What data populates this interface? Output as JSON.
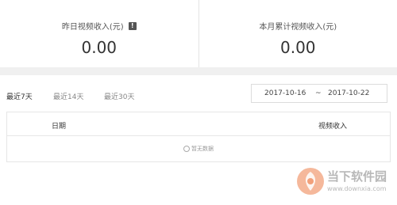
{
  "stats": [
    {
      "title": "昨日视频收入(元)",
      "value": "0.00",
      "warning_glyph": "!"
    },
    {
      "title": "本月累计视频收入(元)",
      "value": "0.00"
    }
  ],
  "tabs": [
    "最近7天",
    "最近14天",
    "最近30天"
  ],
  "active_tab": "最近7天",
  "date_range": {
    "start": "2017-10-16",
    "separator": "~",
    "end": "2017-10-22"
  },
  "table": {
    "columns": [
      "日期",
      "视频收入"
    ],
    "empty_text": "暂无数据"
  },
  "watermark": {
    "name": "当下软件园",
    "url": "www.downxia.com"
  },
  "icons": {
    "warning": "warning-icon",
    "empty": "empty-circle-icon",
    "logo": "downxia-logo-icon"
  }
}
